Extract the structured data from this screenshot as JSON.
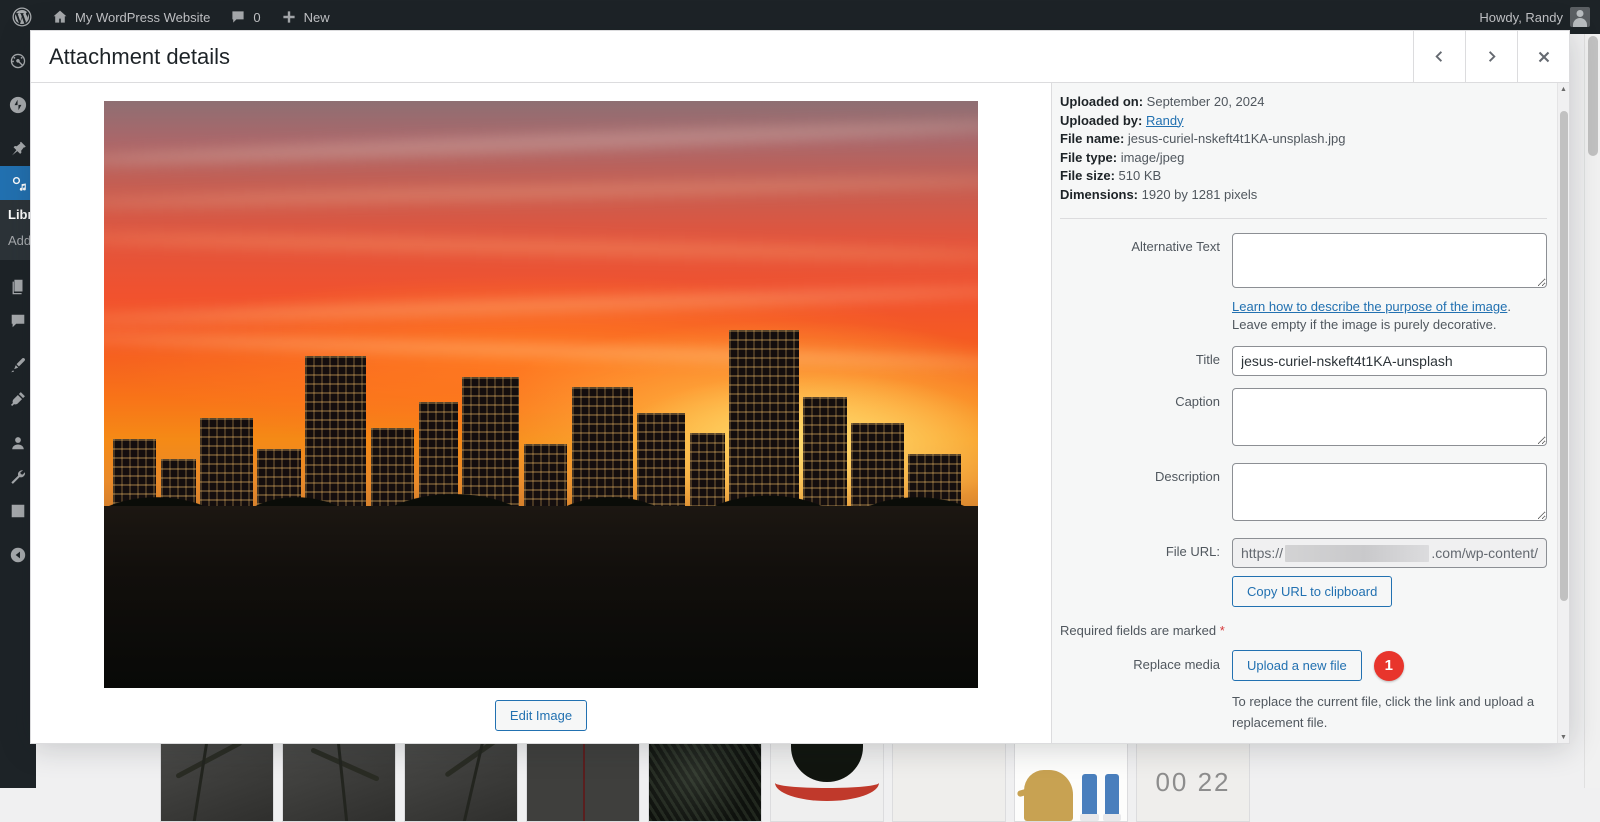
{
  "adminbar": {
    "logo_icon": "wordpress-logo-icon",
    "site_icon": "home-icon",
    "site_name": "My WordPress Website",
    "comments_icon": "comment-bubble-icon",
    "comments_count": "0",
    "new_icon": "plus-icon",
    "new_label": "New",
    "howdy": "Howdy, Randy",
    "avatar": "user-avatar"
  },
  "adminmenu": {
    "items": [
      {
        "icon": "dashboard-gauge-icon",
        "name": "dashboard",
        "current": false
      },
      {
        "icon": "jetpack-lightning-icon",
        "name": "jetpack",
        "current": false
      },
      {
        "icon": "pushpin-posts-icon",
        "name": "posts",
        "current": false
      },
      {
        "icon": "media-camera-icon",
        "name": "media",
        "current": true
      }
    ],
    "submenu": [
      {
        "label": "Library",
        "current": true
      },
      {
        "label": "Add New",
        "current": false
      }
    ],
    "items_after": [
      {
        "icon": "pages-book-icon",
        "name": "pages",
        "current": false
      },
      {
        "icon": "comments-bubble-icon",
        "name": "comments",
        "current": false
      },
      {
        "icon": "appearance-brush-icon",
        "name": "appearance",
        "current": false
      },
      {
        "icon": "plugins-plug-icon",
        "name": "plugins",
        "current": false
      },
      {
        "icon": "users-person-icon",
        "name": "users",
        "current": false
      },
      {
        "icon": "tools-wrench-icon",
        "name": "tools",
        "current": false
      },
      {
        "icon": "settings-sliders-icon",
        "name": "settings",
        "current": false
      },
      {
        "icon": "collapse-menu-arrow-icon",
        "name": "collapse-menu",
        "current": false
      }
    ]
  },
  "modal": {
    "title": "Attachment details",
    "prev_icon": "chevron-left-icon",
    "next_icon": "chevron-right-icon",
    "close_icon": "close-x-icon"
  },
  "preview": {
    "image_alt": "Los Angeles downtown skyline at sunset with orange red sky",
    "edit_image_label": "Edit Image"
  },
  "meta": {
    "uploaded_on_label": "Uploaded on:",
    "uploaded_on_value": "September 20, 2024",
    "uploaded_by_label": "Uploaded by:",
    "uploaded_by_value": "Randy",
    "file_name_label": "File name:",
    "file_name_value": "jesus-curiel-nskeft4t1KA-unsplash.jpg",
    "file_type_label": "File type:",
    "file_type_value": "image/jpeg",
    "file_size_label": "File size:",
    "file_size_value": "510 KB",
    "dimensions_label": "Dimensions:",
    "dimensions_value": "1920 by 1281 pixels"
  },
  "form": {
    "alt_label": "Alternative Text",
    "alt_value": "",
    "alt_placeholder": "",
    "alt_help_link": "Learn how to describe the purpose of the image",
    "alt_help_rest": ". Leave empty if the image is purely decorative.",
    "title_label": "Title",
    "title_value": "jesus-curiel-nskeft4t1KA-unsplash",
    "caption_label": "Caption",
    "caption_value": "",
    "description_label": "Description",
    "description_value": "",
    "file_url_label": "File URL:",
    "file_url_prefix": "https://",
    "file_url_suffix": ".com/wp-content/",
    "copy_url_label": "Copy URL to clipboard",
    "required_text": "Required fields are marked",
    "required_star": "*",
    "replace_media_label": "Replace media",
    "upload_new_file_label": "Upload a new file",
    "annotation_badge": "1",
    "replace_help": "To replace the current file, click the link and upload a replacement file."
  },
  "colors": {
    "accent": "#2271b1",
    "admin_bg": "#1d2327",
    "badge_red": "#e8352c",
    "required_red": "#d63638"
  },
  "media_grid": {
    "thumbnails": [
      {
        "name": "thumb-plant-1",
        "kind": "t-plant"
      },
      {
        "name": "thumb-plant-2",
        "kind": "t-plant t-plant2"
      },
      {
        "name": "thumb-plant-3",
        "kind": "t-plant t-plant3"
      },
      {
        "name": "thumb-stem",
        "kind": "t-stem"
      },
      {
        "name": "thumb-dark-foliage",
        "kind": "t-dark"
      },
      {
        "name": "thumb-red-graphic",
        "kind": "t-red"
      },
      {
        "name": "thumb-blank",
        "kind": "t-blank"
      },
      {
        "name": "thumb-dog-illustration",
        "kind": "t-dog"
      },
      {
        "name": "thumb-numbers",
        "kind": "t-num",
        "text": "00 22"
      }
    ]
  }
}
